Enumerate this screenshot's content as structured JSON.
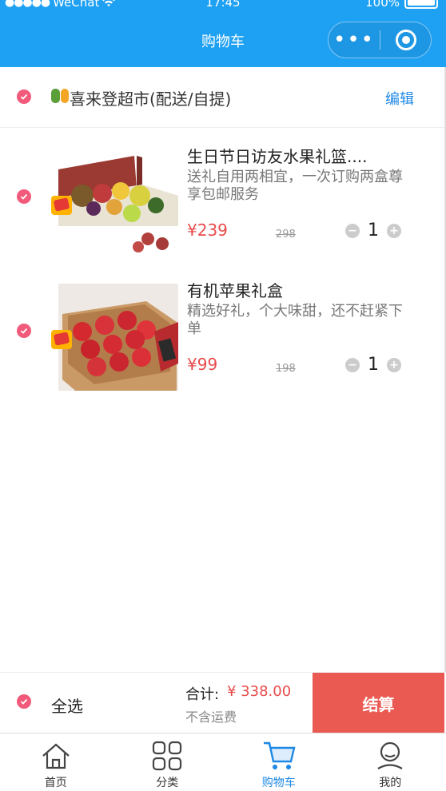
{
  "status_bar": {
    "carrier": "WeChat",
    "time": "17:45",
    "battery": "100%"
  },
  "nav": {
    "title": "购物车"
  },
  "shop": {
    "name": "喜来登超市(配送/自提)",
    "edit_label": "编辑"
  },
  "items": [
    {
      "name": "生日节日访友水果礼篮....",
      "desc": "送礼自用两相宜，一次订购两盒尊享包邮服务",
      "price": "¥239",
      "old_price": "298",
      "qty": "1"
    },
    {
      "name": "有机苹果礼盒",
      "desc": "精选好礼，个大味甜，还不赶紧下单",
      "price": "¥99",
      "old_price": "198",
      "qty": "1"
    }
  ],
  "settle": {
    "select_all": "全选",
    "total_label": "合计:",
    "total_value": "¥ 338.00",
    "freight": "不含运费",
    "checkout": "结算"
  },
  "tabs": [
    {
      "label": "首页",
      "icon": "home-icon"
    },
    {
      "label": "分类",
      "icon": "category-icon"
    },
    {
      "label": "购物车",
      "icon": "cart-icon"
    },
    {
      "label": "我的",
      "icon": "profile-icon"
    }
  ],
  "colors": {
    "header": "#1fa1f3",
    "accent": "#f25a7b",
    "price": "#e94b4b",
    "checkout": "#eb5a52",
    "active_tab": "#1e88e5"
  }
}
